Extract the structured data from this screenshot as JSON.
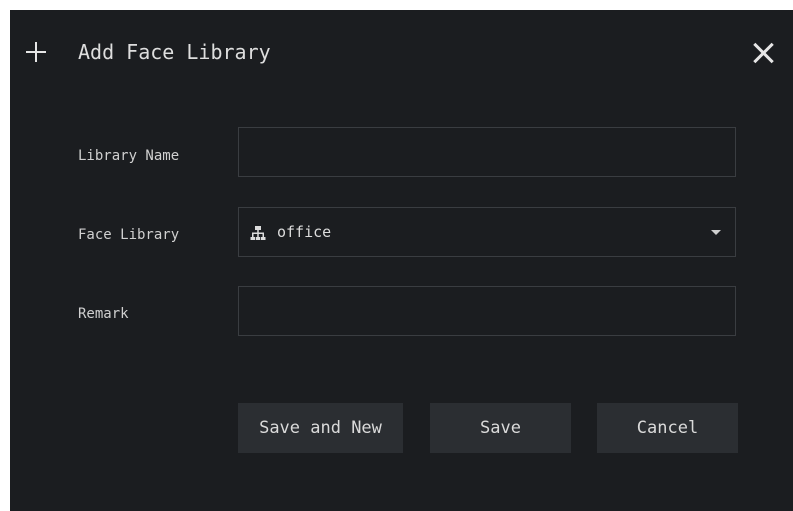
{
  "dialog": {
    "title": "Add Face Library",
    "close_label": "close"
  },
  "form": {
    "library_name": {
      "label": "Library Name",
      "value": ""
    },
    "face_library": {
      "label": "Face Library",
      "selected": "office",
      "icon": "org-tree-icon"
    },
    "remark": {
      "label": "Remark",
      "value": ""
    }
  },
  "buttons": {
    "save_and_new": "Save and New",
    "save": "Save",
    "cancel": "Cancel"
  },
  "colors": {
    "background": "#1b1d20",
    "field_border": "#3a3d41",
    "button_bg": "#2b2e32",
    "text": "#d6d6d6"
  }
}
